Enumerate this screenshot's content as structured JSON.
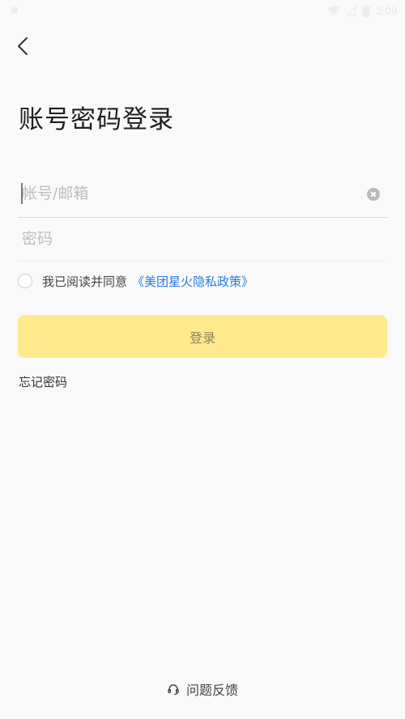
{
  "status_bar": {
    "time": "2:09",
    "icons": [
      "wifi-icon",
      "signal-icon",
      "battery-icon"
    ]
  },
  "header": {
    "back_icon": "chevron-left-icon",
    "title": "账号密码登录"
  },
  "form": {
    "account": {
      "placeholder": "帐号/邮箱",
      "value": "",
      "clear_icon": "clear-circle-icon"
    },
    "password": {
      "placeholder": "密码",
      "value": ""
    },
    "agreement": {
      "checked": false,
      "text": "我已阅读并同意",
      "link": "《美团星火隐私政策》"
    },
    "login_button": "登录",
    "forgot_password": "忘记密码"
  },
  "footer": {
    "feedback_icon": "headset-icon",
    "feedback_label": "问题反馈"
  },
  "colors": {
    "background": "#f9f9f9",
    "login_button_bg": "#ffe98d",
    "login_button_text": "#8c8460",
    "link": "#2a7be4",
    "title": "#1f1f1f"
  }
}
